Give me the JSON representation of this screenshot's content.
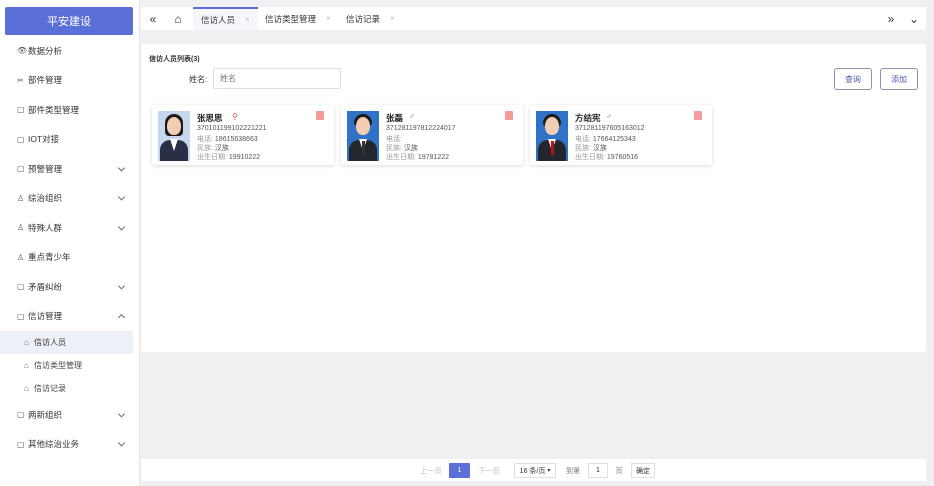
{
  "sidebar": {
    "brand": "平安建设",
    "items": [
      {
        "label": "数据分析",
        "icon": "eye-icon",
        "glyph": "👁"
      },
      {
        "label": "部件管理",
        "icon": "scissors-icon",
        "glyph": "✂"
      },
      {
        "label": "部件类型管理",
        "icon": "document-icon",
        "glyph": "▢"
      },
      {
        "label": "IOT对接",
        "icon": "document-icon",
        "glyph": "▢"
      },
      {
        "label": "预警管理",
        "icon": "document-icon",
        "glyph": "▢"
      },
      {
        "label": "综治组织",
        "icon": "user-icon",
        "glyph": "♙"
      },
      {
        "label": "特殊人群",
        "icon": "user-icon",
        "glyph": "♙"
      },
      {
        "label": "重点青少年",
        "icon": "user-icon",
        "glyph": "♙"
      },
      {
        "label": "矛盾纠纷",
        "icon": "document-icon",
        "glyph": "▢"
      },
      {
        "label": "信访管理",
        "icon": "document-icon",
        "glyph": "▢"
      },
      {
        "label": "两新组织",
        "icon": "document-icon",
        "glyph": "▢"
      },
      {
        "label": "其他综治业务",
        "icon": "document-icon",
        "glyph": "▢"
      }
    ],
    "sub_items": [
      {
        "label": "信访人员",
        "glyph": "⌂"
      },
      {
        "label": "信访类型管理",
        "glyph": "⌂"
      },
      {
        "label": "信访记录",
        "glyph": "⌂"
      }
    ]
  },
  "topbar": {
    "back_glyph": "«",
    "home_glyph": "⌂",
    "forward_glyph": "»",
    "more_glyph": "⌄",
    "close_glyph": "×",
    "tabs": [
      {
        "label": "信访人员"
      },
      {
        "label": "信访类型管理"
      },
      {
        "label": "信访记录"
      }
    ]
  },
  "panel": {
    "list_title": "信访人员列表(3)",
    "name_label": "姓名:",
    "name_placeholder": "姓名",
    "query_button": "查询",
    "add_button": "添加"
  },
  "cards": [
    {
      "name": "张思思",
      "id": "370101199102221221",
      "phone_label": "电话:",
      "phone": "18615638663",
      "ethnic_label": "民族:",
      "ethnic": "汉族",
      "birth_label": "出生日期:",
      "birth": "19910222",
      "icon_glyph": "⚲",
      "icon_color": "#e05555"
    },
    {
      "name": "张磊",
      "id": "371281197812224017",
      "phone_label": "电话:",
      "phone": "",
      "ethnic_label": "民族:",
      "ethnic": "汉族",
      "birth_label": "出生日期:",
      "birth": "19781222",
      "icon_glyph": "♂",
      "icon_color": "#666666"
    },
    {
      "name": "方结宪",
      "id": "371281197605163012",
      "phone_label": "电话:",
      "phone": "17664125343",
      "ethnic_label": "民族:",
      "ethnic": "汉族",
      "birth_label": "出生日期:",
      "birth": "19760516",
      "icon_glyph": "♂",
      "icon_color": "#666666"
    }
  ],
  "pagination": {
    "prev": "上一页",
    "current": "1",
    "next": "下一页",
    "page_size": "16 条/页",
    "goto_label": "到第",
    "goto_value": "1",
    "page_unit": "页",
    "confirm": "确定"
  },
  "colors": {
    "accent": "#5b6fd8",
    "female_photo_bg": "#c6d7ee",
    "male_photo_bg": "#2f72c7"
  }
}
